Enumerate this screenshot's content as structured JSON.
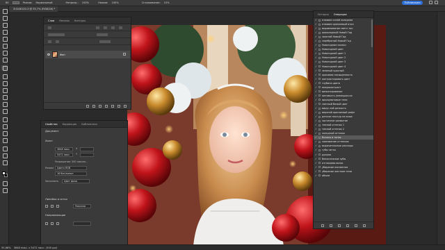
{
  "options_bar": {
    "size": "60",
    "mode_label": "Режим:",
    "mode_value": "Нормальный",
    "opacity_label": "Непрозр.:",
    "opacity_value": "100%",
    "flow_label": "Нажим:",
    "flow_value": "100%",
    "smoothing_label": "Сглаживание:",
    "smoothing_value": "10%",
    "publish_label": "Публикация"
  },
  "document_tab": {
    "title": "2U2A8120-3 @ 55,7% (RGB/16) *"
  },
  "layers_panel": {
    "tabs": [
      "Слои",
      "Каналы",
      "Контуры"
    ],
    "active_tab": "Слои",
    "layer_name": "Фон"
  },
  "properties_panel": {
    "tabs": [
      "Свойства",
      "Коррекция",
      "Библиотеки"
    ],
    "active_tab": "Свойства",
    "document_label": "Документ",
    "canvas_section": "Холст",
    "width_value": "3648 пикс.",
    "height_value": "5472 пикс.",
    "x_label": "X",
    "y_label": "Y",
    "resolution": "Разрешение: 300 пиксел...",
    "mode_label": "Режим",
    "mode_value": "Цвета RGB",
    "depth_value": "16 бит/канал",
    "fill_label": "Заполнить",
    "fill_value": "Цвет фона",
    "rulers_section": "Линейки и сетки",
    "units_value": "Пиксели",
    "guides_section": "Направляющие"
  },
  "history_panel": {
    "tabs": [
      "История",
      "Операции"
    ],
    "active_tab": "Операции",
    "selected_index": 28,
    "items": [
      "отаявие синей холодная",
      "отаявие оранжевый итал",
      "выравнивание светл тон",
      "шоколадный Новый Год",
      "золотой Новый Год",
      "серебряный Новый Год",
      "Новогодние сказки",
      "Новогодний цвет",
      "Новогодний цвет 1",
      "Новогодний цвет 2",
      "Новогодний цвет 3",
      "Новогодний цвет 4",
      "зеленый красный",
      "красивая насыщенность",
      "контрастировать цвет",
      "глубина цвета",
      "микроконтраст",
      "вильетирование",
      "матовость (немецкая ка",
      "яркая/матовые тени",
      "светлый белый цвет",
      "вирус кий резкость",
      "верхний оранжевый рефл",
      "детали текстур на коже",
      "частичное размытие",
      "теплый оттенок 1",
      "теплый оттенок 2",
      "холодный оттенок",
      "Волосы в тонах",
      "сиянование оттенков",
      "выразительные ресницы",
      "губы четко",
      "румяна",
      "белоснежные зубы",
      "отглажива волос",
      "убирание пигментов",
      "убирание жесткие тени",
      "объем"
    ]
  },
  "status_bar": {
    "zoom": "55,66%",
    "doc_size": "3648 пикс. x 5472 пикс. (300 ppi)"
  }
}
